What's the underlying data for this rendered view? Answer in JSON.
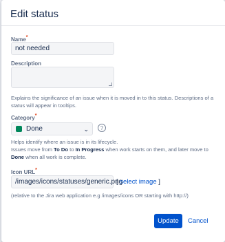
{
  "dialog": {
    "title": "Edit status",
    "update_label": "Update",
    "cancel_label": "Cancel"
  },
  "name_field": {
    "label": "Name",
    "required_mark": "*",
    "value": "not needed"
  },
  "description_field": {
    "label": "Description",
    "value": "",
    "help": "Explains the significance of an issue when it is moved in to this status. Descriptions of a status will appear in tooltips."
  },
  "category_field": {
    "label": "Category",
    "required_mark": "*",
    "selected": "Done",
    "swatch_color": "#00875a",
    "help_icon": "?",
    "help_line1": "Helps identify where an issue is in its lifecycle.",
    "help_line2_a": "Issues move from ",
    "help_line2_b": "To Do",
    "help_line2_c": " to ",
    "help_line2_d": "In Progress",
    "help_line2_e": " when work starts on them, and later move to",
    "help_line3_a": "Done",
    "help_line3_b": " when all work is complete."
  },
  "icon_url_field": {
    "label": "Icon URL",
    "required_mark": "*",
    "value": "/images/icons/statuses/generic.png",
    "select_open": "[ ",
    "select_link": "select image",
    "select_close": " ]",
    "help": "(relative to the Jira web application e.g /images/icons OR starting with http://)"
  },
  "colors": {
    "primary": "#0052cc",
    "required": "#de350b",
    "done": "#00875a"
  }
}
